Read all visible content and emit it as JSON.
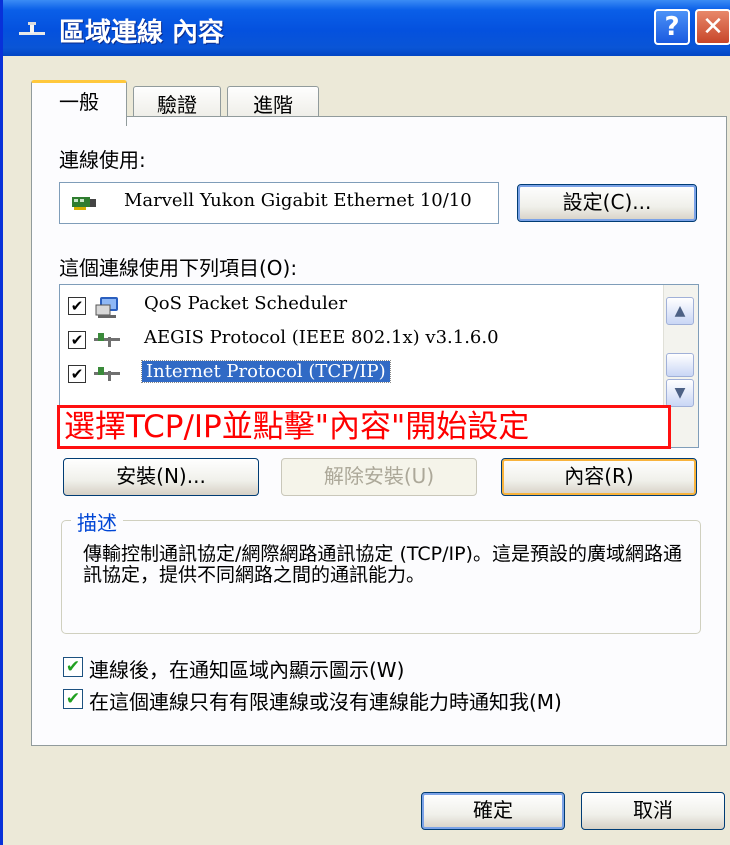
{
  "window": {
    "title": "區域連線 內容",
    "help_glyph": "?",
    "close_glyph": "✕"
  },
  "tabs": [
    {
      "label": "一般",
      "active": true
    },
    {
      "label": "驗證",
      "active": false
    },
    {
      "label": "進階",
      "active": false
    }
  ],
  "general": {
    "connect_using_label": "連線使用:",
    "adapter_name": "Marvell Yukon Gigabit Ethernet 10/10",
    "configure_button": "設定(C)...",
    "items_label": "這個連線使用下列項目(O):",
    "items": [
      {
        "label": "QoS Packet Scheduler",
        "checked": true,
        "icon": "qos-scheduler-icon",
        "selected": false
      },
      {
        "label": "AEGIS Protocol (IEEE 802.1x) v3.1.6.0",
        "checked": true,
        "icon": "network-protocol-icon",
        "selected": false
      },
      {
        "label": "Internet Protocol (TCP/IP)",
        "checked": true,
        "icon": "network-protocol-icon",
        "selected": true
      }
    ],
    "annotation": "選擇TCP/IP並點擊\"內容\"開始設定",
    "install_button": "安裝(N)...",
    "uninstall_button": "解除安裝(U)",
    "properties_button": "內容(R)",
    "description_legend": "描述",
    "description_text": "傳輸控制通訊協定/網際網路通訊協定 (TCP/IP)。這是預設的廣域網路通訊協定，提供不同網路之間的通訊能力。",
    "show_icon_label": "連線後，在通知區域內顯示圖示(W)",
    "show_icon_checked": true,
    "notify_label": "在這個連線只有有限連線或沒有連線能力時通知我(M)",
    "notify_checked": true
  },
  "footer": {
    "ok_button": "確定",
    "cancel_button": "取消"
  },
  "colors": {
    "titlebar": "#0451de",
    "annotation_red": "#ff0000",
    "selection": "#316ac5",
    "legend_blue": "#0046d5"
  }
}
